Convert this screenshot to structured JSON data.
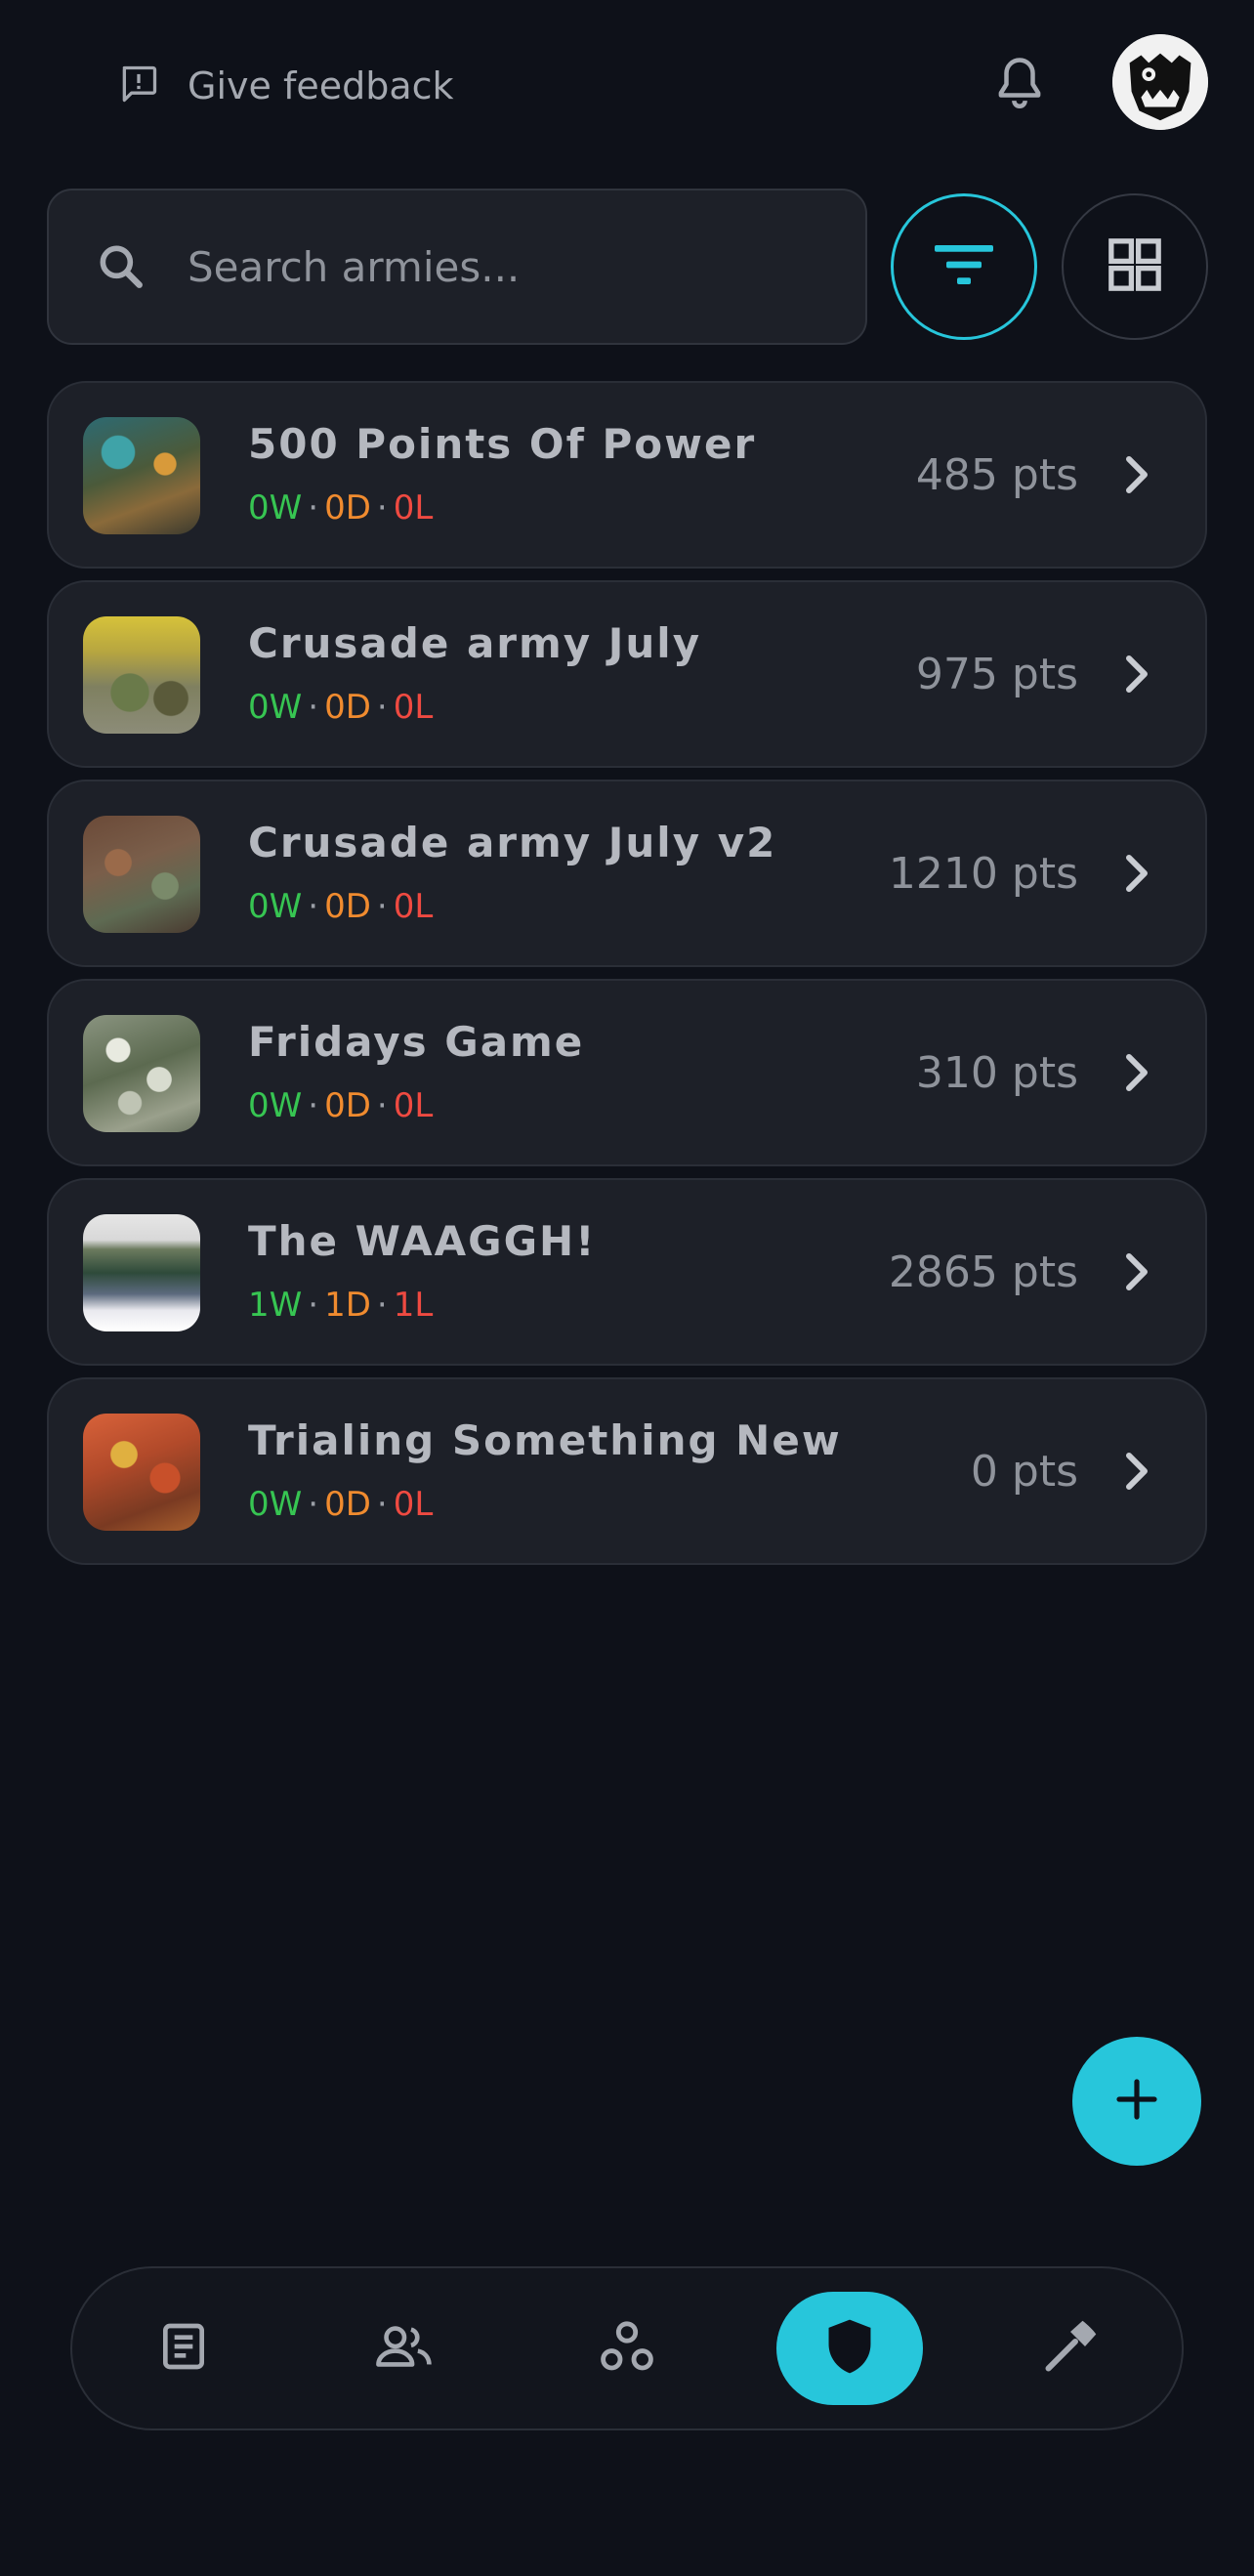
{
  "header": {
    "feedback_label": "Give feedback",
    "icons": [
      "feedback-icon",
      "bell-icon",
      "avatar"
    ]
  },
  "search": {
    "placeholder": "Search armies...",
    "value": ""
  },
  "armies": [
    {
      "name": "500 Points Of Power",
      "wins": "0W",
      "draws": "0D",
      "losses": "0L",
      "points": "485 pts"
    },
    {
      "name": "Crusade army July",
      "wins": "0W",
      "draws": "0D",
      "losses": "0L",
      "points": "975 pts"
    },
    {
      "name": "Crusade army July v2",
      "wins": "0W",
      "draws": "0D",
      "losses": "0L",
      "points": "1210 pts"
    },
    {
      "name": "Fridays Game",
      "wins": "0W",
      "draws": "0D",
      "losses": "0L",
      "points": "310 pts"
    },
    {
      "name": "The WAAGGH!",
      "wins": "1W",
      "draws": "1D",
      "losses": "1L",
      "points": "2865 pts"
    },
    {
      "name": "Trialing Something New",
      "wins": "0W",
      "draws": "0D",
      "losses": "0L",
      "points": "0 pts"
    }
  ],
  "record_separator": "·",
  "bottom_nav": {
    "items": [
      "document-icon",
      "people-icon",
      "nodes-icon",
      "shield-icon",
      "axe-icon"
    ],
    "active": "shield-icon"
  },
  "colors": {
    "accent": "#27c6db",
    "background": "#0e1119",
    "card": "#1d2028",
    "win": "#37c552",
    "draw": "#f08b2f",
    "loss": "#ef4a41"
  }
}
